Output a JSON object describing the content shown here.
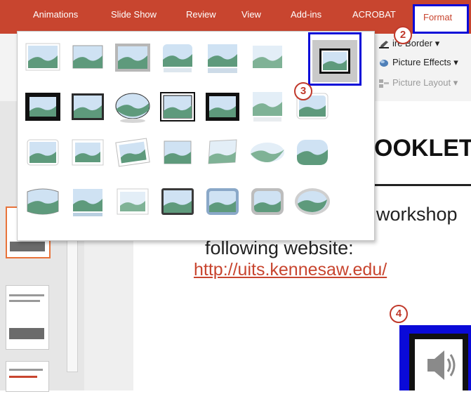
{
  "tabs": [
    {
      "label": "Animations"
    },
    {
      "label": "Slide Show"
    },
    {
      "label": "Review"
    },
    {
      "label": "View"
    },
    {
      "label": "Add-ins"
    },
    {
      "label": "ACROBAT"
    }
  ],
  "active_tab": {
    "label": "Format"
  },
  "ribbon": {
    "picture_border": "ire Border",
    "picture_effects": "Picture Effects",
    "picture_layout": "Picture Layout"
  },
  "gallery": {
    "rows": 4,
    "columns": 7,
    "selected_index": 6
  },
  "slide": {
    "title_fragment": "OOKLET",
    "body_line1": "workshop",
    "body_line2": "following website:",
    "link": "http://uits.kennesaw.edu/"
  },
  "callouts": {
    "c2": "2",
    "c3": "3",
    "c4": "4"
  },
  "colors": {
    "accent": "#c8452f",
    "highlight": "#0a0ad8",
    "callout": "#c0392b"
  }
}
